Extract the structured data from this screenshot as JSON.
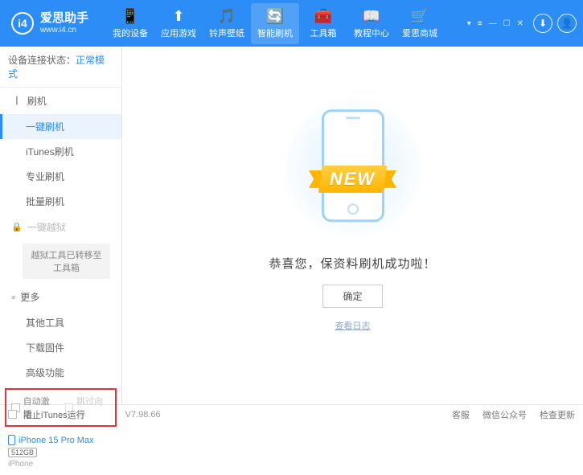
{
  "header": {
    "brand_title": "爱思助手",
    "brand_sub": "www.i4.cn",
    "logo_letter": "i4",
    "nav": [
      {
        "icon": "📱",
        "label": "我的设备"
      },
      {
        "icon": "⬆",
        "label": "应用游戏"
      },
      {
        "icon": "🎵",
        "label": "铃声壁纸"
      },
      {
        "icon": "🔄",
        "label": "智能刷机"
      },
      {
        "icon": "🧰",
        "label": "工具箱"
      },
      {
        "icon": "📖",
        "label": "教程中心"
      },
      {
        "icon": "🛒",
        "label": "爱思商城"
      }
    ],
    "download_icon": "⬇",
    "user_icon": "👤"
  },
  "sidebar": {
    "conn_label": "设备连接状态：",
    "conn_value": "正常模式",
    "group_flash": "刷机",
    "items_flash": [
      "一键刷机",
      "iTunes刷机",
      "专业刷机",
      "批量刷机"
    ],
    "group_jailbreak": "一键越狱",
    "jailbreak_note": "越狱工具已转移至工具箱",
    "group_more": "更多",
    "items_more": [
      "其他工具",
      "下载固件",
      "高级功能"
    ],
    "chk_auto": "自动激活",
    "chk_skip": "跳过向导",
    "device_name": "iPhone 15 Pro Max",
    "device_storage": "512GB",
    "device_type": "iPhone"
  },
  "main": {
    "ribbon_text": "NEW",
    "message": "恭喜您，保资料刷机成功啦！",
    "ok": "确定",
    "view_log": "查看日志"
  },
  "statusbar": {
    "block_itunes": "阻止iTunes运行",
    "version": "V7.98.66",
    "links": [
      "客服",
      "微信公众号",
      "检查更新"
    ]
  }
}
